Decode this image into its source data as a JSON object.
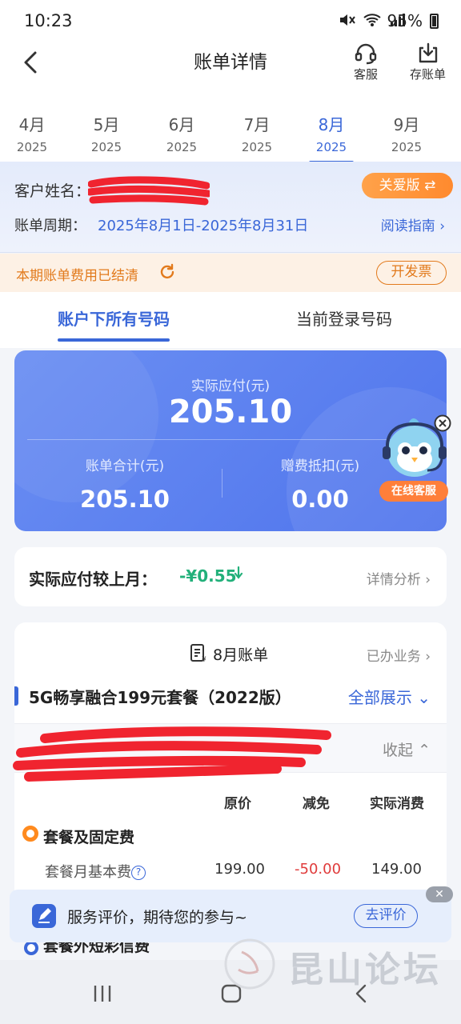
{
  "status_bar": {
    "time": "10:23",
    "battery": "95%"
  },
  "header": {
    "title": "账单详情",
    "service_label": "客服",
    "save_label": "存账单"
  },
  "months": [
    {
      "month": "4月",
      "year": "2025"
    },
    {
      "month": "5月",
      "year": "2025"
    },
    {
      "month": "6月",
      "year": "2025"
    },
    {
      "month": "7月",
      "year": "2025"
    },
    {
      "month": "8月",
      "year": "2025",
      "active": true
    },
    {
      "month": "9月",
      "year": "2025"
    }
  ],
  "customer": {
    "name_label": "客户姓名：",
    "care_mode": "关爱版 ⇄",
    "period_label": "账单周期：",
    "period_value": "2025年8月1日-2025年8月31日",
    "guide_link": "阅读指南"
  },
  "settlement": {
    "text": "本期账单费用已结清",
    "invoice_button": "开发票"
  },
  "account_tabs": {
    "all_numbers": "账户下所有号码",
    "current_number": "当前登录号码"
  },
  "summary": {
    "actual_label": "实际应付(元)",
    "actual_amount": "205.10",
    "total_label": "账单合计(元)",
    "total_amount": "205.10",
    "gift_label": "赠费抵扣(元)",
    "gift_amount": "0.00"
  },
  "online_service": {
    "label": "在线客服"
  },
  "compare": {
    "label": "实际应付较上月：",
    "value": "-¥0.55",
    "link": "详情分析"
  },
  "bill": {
    "title": "8月账单",
    "done_business": "已办业务",
    "plan_name": "5G畅享融合199元套餐（2022版）",
    "show_all": "全部展示",
    "collapse": "收起",
    "columns": [
      "原价",
      "减免",
      "实际消费"
    ],
    "category": "套餐及固定费",
    "items": [
      {
        "name": "套餐月基本费",
        "original": "199.00",
        "discount": "-50.00",
        "actual": "149.00"
      }
    ],
    "next_category_peek": "套餐外短彩信费"
  },
  "feedback": {
    "text": "服务评价，期待您的参与~",
    "button": "去评价",
    "close": "✕"
  },
  "watermark": {
    "text": "昆山论坛"
  },
  "colors": {
    "accent": "#3a67d8",
    "orange": "#ff8a2e",
    "green": "#22b07a",
    "red": "#e03b3b"
  }
}
